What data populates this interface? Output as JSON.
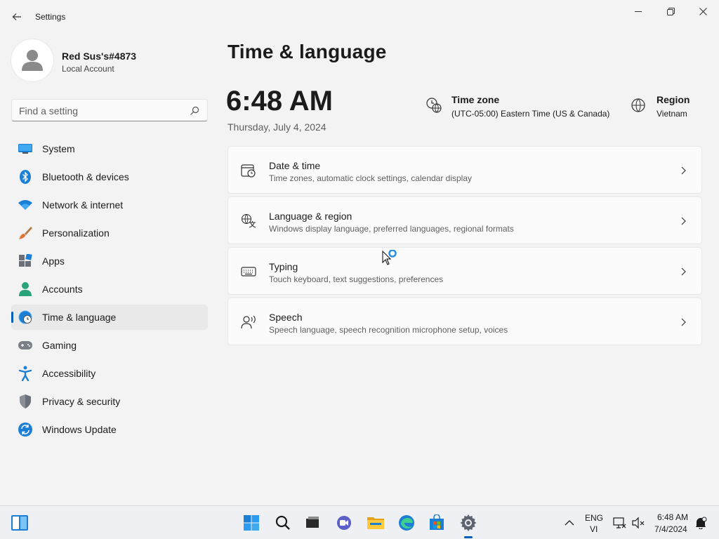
{
  "window": {
    "title": "Settings",
    "controls": {
      "minimize": "minimize",
      "maximize": "maximize",
      "close": "close"
    }
  },
  "profile": {
    "name": "Red Sus's#4873",
    "account_type": "Local Account"
  },
  "search": {
    "placeholder": "Find a setting"
  },
  "sidebar": {
    "items": [
      {
        "label": "System",
        "icon": "system-icon",
        "active": false
      },
      {
        "label": "Bluetooth & devices",
        "icon": "bluetooth-icon",
        "active": false
      },
      {
        "label": "Network & internet",
        "icon": "wifi-icon",
        "active": false
      },
      {
        "label": "Personalization",
        "icon": "brush-icon",
        "active": false
      },
      {
        "label": "Apps",
        "icon": "apps-icon",
        "active": false
      },
      {
        "label": "Accounts",
        "icon": "person-icon",
        "active": false
      },
      {
        "label": "Time & language",
        "icon": "globe-clock-icon",
        "active": true
      },
      {
        "label": "Gaming",
        "icon": "gamepad-icon",
        "active": false
      },
      {
        "label": "Accessibility",
        "icon": "accessibility-icon",
        "active": false
      },
      {
        "label": "Privacy & security",
        "icon": "shield-icon",
        "active": false
      },
      {
        "label": "Windows Update",
        "icon": "update-icon",
        "active": false
      }
    ]
  },
  "main": {
    "title": "Time & language",
    "clock": {
      "time": "6:48 AM",
      "date": "Thursday, July 4, 2024"
    },
    "time_zone": {
      "title": "Time zone",
      "value": "(UTC-05:00) Eastern Time (US & Canada)"
    },
    "region": {
      "title": "Region",
      "value": "Vietnam"
    },
    "cards": [
      {
        "title": "Date & time",
        "subtitle": "Time zones, automatic clock settings, calendar display",
        "icon": "calendar-clock-icon"
      },
      {
        "title": "Language & region",
        "subtitle": "Windows display language, preferred languages, regional formats",
        "icon": "language-icon"
      },
      {
        "title": "Typing",
        "subtitle": "Touch keyboard, text suggestions, preferences",
        "icon": "keyboard-icon"
      },
      {
        "title": "Speech",
        "subtitle": "Speech language, speech recognition microphone setup, voices",
        "icon": "speech-icon"
      }
    ]
  },
  "taskbar": {
    "apps": [
      "widgets",
      "start",
      "search",
      "task-view",
      "chat",
      "file-explorer",
      "edge",
      "store",
      "settings"
    ],
    "active_app": "settings",
    "input_lang_1": "ENG",
    "input_lang_2": "VI",
    "time": "6:48 AM",
    "date": "7/4/2024"
  },
  "colors": {
    "accent": "#005fb8",
    "background": "#f3f3f3",
    "card": "#fbfbfb"
  }
}
